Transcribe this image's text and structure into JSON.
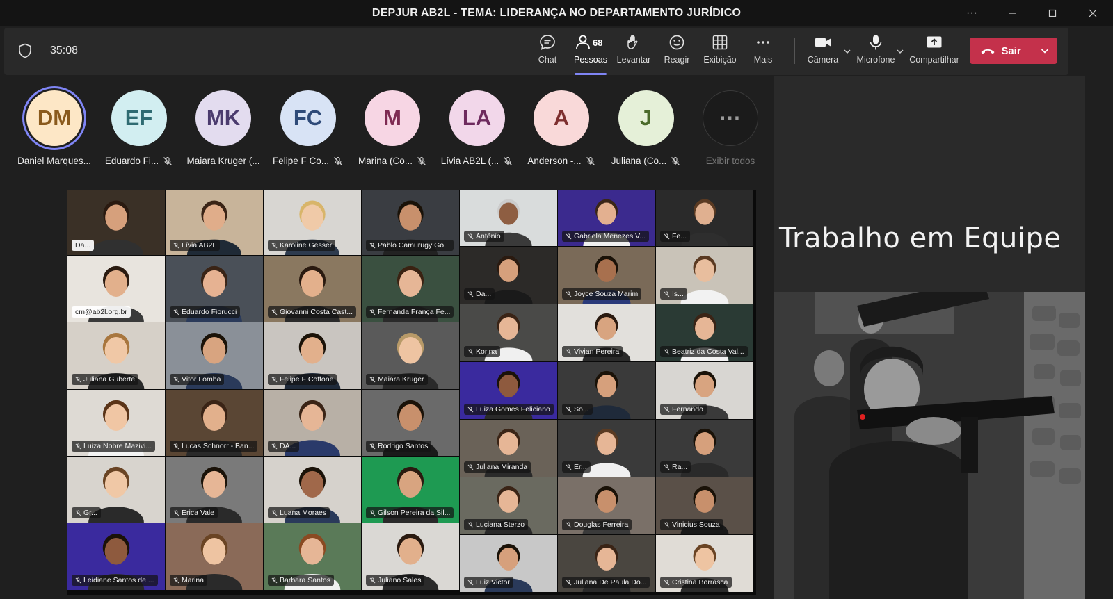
{
  "window": {
    "title": "DEPJUR AB2L - TEMA: LIDERANÇA NO DEPARTAMENTO JURÍDICO"
  },
  "toolbar": {
    "timer": "35:08",
    "participant_count": "68",
    "buttons": {
      "chat": "Chat",
      "people": "Pessoas",
      "raise": "Levantar",
      "react": "Reagir",
      "view": "Exibição",
      "more": "Mais",
      "camera": "Câmera",
      "mic": "Microfone",
      "share": "Compartilhar",
      "leave": "Sair"
    }
  },
  "avatars": [
    {
      "initials": "DM",
      "name": "Daniel Marques...",
      "bg": "#fde7c6",
      "fg": "#8a5a1c",
      "speaking": true,
      "muted": false
    },
    {
      "initials": "EF",
      "name": "Eduardo Fi...",
      "bg": "#d2eef1",
      "fg": "#2f6b72",
      "muted": true
    },
    {
      "initials": "MK",
      "name": "Maiara Kruger (...",
      "bg": "#e3dcef",
      "fg": "#4b3b6e",
      "muted": false
    },
    {
      "initials": "FC",
      "name": "Felipe F Co...",
      "bg": "#d8e3f5",
      "fg": "#2e4a78",
      "muted": true
    },
    {
      "initials": "M",
      "name": "Marina (Co...",
      "bg": "#f7d6e4",
      "fg": "#7e2a52",
      "muted": true
    },
    {
      "initials": "LA",
      "name": "Lívia AB2L (...",
      "bg": "#f2d7ea",
      "fg": "#6e2a5e",
      "muted": true
    },
    {
      "initials": "A",
      "name": "Anderson -...",
      "bg": "#f9d9d9",
      "fg": "#7e2f2f",
      "muted": true
    },
    {
      "initials": "J",
      "name": "Juliana (Co...",
      "bg": "#e5f0d8",
      "fg": "#4a6a2a",
      "muted": true
    }
  ],
  "show_all": {
    "label": "Exibir todos"
  },
  "tiles": [
    {
      "name": "Da...",
      "bg": "#3a3026",
      "skin": "#d6a07c",
      "hair": "#2a1a10",
      "shirt": "#303030",
      "light": true
    },
    {
      "name": "Lívia AB2L",
      "bg": "#c8b49a",
      "skin": "#e0ad8a",
      "hair": "#3a2416",
      "shirt": "#1f2a36"
    },
    {
      "name": "Karoline Gesser",
      "bg": "#d8d6d2",
      "skin": "#f0caa8",
      "hair": "#d8b56a",
      "shirt": "#2e3b4e"
    },
    {
      "name": "Pablo Camurugy Go...",
      "bg": "#3a3d42",
      "skin": "#c8906c",
      "hair": "#1a1208",
      "shirt": "#222222"
    },
    {
      "name": "Antônio",
      "bg": "#d9dcdc",
      "skin": "#8e5e42",
      "hair": "#cccccc",
      "shirt": "#3a3a3a"
    },
    {
      "name": "Gabriela Menezes V...",
      "bg": "#3b2a8e",
      "skin": "#e3b090",
      "hair": "#3a2618",
      "shirt": "#f0f0f0"
    },
    {
      "name": "Fe...",
      "bg": "#2a2a2a",
      "skin": "#e0b090",
      "hair": "#5a3a22",
      "shirt": "#2e2e2e"
    },
    {
      "name": "cm@ab2l.org.br",
      "bg": "#e8e4de",
      "skin": "#e2b08c",
      "hair": "#2a1a10",
      "shirt": "#3a3a3a",
      "light": true
    },
    {
      "name": "Eduardo Fiorucci",
      "bg": "#4a5058",
      "skin": "#e6b292",
      "hair": "#3a2416",
      "shirt": "#2a3a5a"
    },
    {
      "name": "Giovanni Costa Cast...",
      "bg": "#8a7860",
      "skin": "#e3b08c",
      "hair": "#2a1a10",
      "shirt": "#2a2a2a"
    },
    {
      "name": "Fernanda França Fe...",
      "bg": "#3a5040",
      "skin": "#e6b696",
      "hair": "#3a2212",
      "shirt": "#2a2a2a"
    },
    {
      "name": "Da...",
      "bg": "#2c2a28",
      "skin": "#d6a07c",
      "hair": "#2a1a10",
      "shirt": "#1a1a1a"
    },
    {
      "name": "Joyce Souza Marim",
      "bg": "#7a6a58",
      "skin": "#a8704e",
      "hair": "#1a1208",
      "shirt": "#2a3a7a"
    },
    {
      "name": "Is...",
      "bg": "#c9c3b8",
      "skin": "#e8be9e",
      "hair": "#5a3a22",
      "shirt": "#f2f2f2"
    },
    {
      "name": "Juliana Guberte",
      "bg": "#d6d0c8",
      "skin": "#f0c8a6",
      "hair": "#a8763e",
      "shirt": "#2a2a2a"
    },
    {
      "name": "Vitor Lomba",
      "bg": "#8a9098",
      "skin": "#d8a480",
      "hair": "#1a1208",
      "shirt": "#2a3a5a"
    },
    {
      "name": "Felipe F Coffone",
      "bg": "#c9c5c0",
      "skin": "#e2b08c",
      "hair": "#1a1208",
      "shirt": "#1f2a3a"
    },
    {
      "name": "Maiara Kruger",
      "bg": "#5a5a5a",
      "skin": "#eec4a2",
      "hair": "#b89a68",
      "shirt": "#2a2a2a"
    },
    {
      "name": "Korina",
      "bg": "#4a4a48",
      "skin": "#e6b696",
      "hair": "#3a2416",
      "shirt": "#f0f0f0"
    },
    {
      "name": "Vivian Pereira",
      "bg": "#e2e0dc",
      "skin": "#d8a480",
      "hair": "#2a1a10",
      "shirt": "#2a2a2a"
    },
    {
      "name": "Beatriz da Costa Val...",
      "bg": "#2a3a34",
      "skin": "#e6b696",
      "hair": "#3a2416",
      "shirt": "#f2f2f2"
    },
    {
      "name": "Luiza Gomes Feliciano",
      "bg": "#3a2a9e",
      "skin": "#8e5a3e",
      "hair": "#1a1208",
      "shirt": "#2a2a2a"
    },
    {
      "name": "So...",
      "bg": "#3a3a3a",
      "skin": "#d6a07c",
      "hair": "#1a1208",
      "shirt": "#1f2a3a"
    },
    {
      "name": "Fernando",
      "bg": "#d8d6d2",
      "skin": "#d8a480",
      "hair": "#1a1208",
      "shirt": "#3a3a3a"
    },
    {
      "name": "Luiza Nobre Mazivi...",
      "bg": "#dedad4",
      "skin": "#f0c6a4",
      "hair": "#5a3418",
      "shirt": "#f4f4f4"
    },
    {
      "name": "Lucas Schnorr - Ban...",
      "bg": "#5a4634",
      "skin": "#e2b08c",
      "hair": "#3a2416",
      "shirt": "#2a2a2a"
    },
    {
      "name": "DA...",
      "bg": "#b8b0a6",
      "skin": "#e6b696",
      "hair": "#3a2416",
      "shirt": "#2a3a6a"
    },
    {
      "name": "Rodrigo Santos",
      "bg": "#6a6a6a",
      "skin": "#c8906c",
      "hair": "#1a1208",
      "shirt": "#1a1a1a"
    },
    {
      "name": "Juliana Miranda",
      "bg": "#6a6258",
      "skin": "#e6b696",
      "hair": "#3a2416",
      "shirt": "#2a2a2a"
    },
    {
      "name": "Er...",
      "bg": "#3a3a3a",
      "skin": "#e6b696",
      "hair": "#5a3a22",
      "shirt": "#f0f0f0"
    },
    {
      "name": "Ra...",
      "bg": "#3a3a3a",
      "skin": "#d6a07c",
      "hair": "#1a1208",
      "shirt": "#2a2a2a"
    },
    {
      "name": "Gr...",
      "bg": "#d8d4ce",
      "skin": "#f0c8a6",
      "hair": "#6a4424",
      "shirt": "#2a2a2a"
    },
    {
      "name": "Érica Vale",
      "bg": "#7a7a7a",
      "skin": "#e6b696",
      "hair": "#1a1208",
      "shirt": "#2a2a2a"
    },
    {
      "name": "Luana Moraes",
      "bg": "#d6d2cc",
      "skin": "#a0684a",
      "hair": "#1a1208",
      "shirt": "#2a3a5a"
    },
    {
      "name": "Gilson Pereira da Sil...",
      "bg": "#1e9a52",
      "skin": "#d8a480",
      "hair": "#2a1a10",
      "shirt": "#2a2a2a"
    },
    {
      "name": "Luciana Sterzo",
      "bg": "#6a6a60",
      "skin": "#e6b696",
      "hair": "#3a2416",
      "shirt": "#2a2a2a"
    },
    {
      "name": "Douglas Ferreira",
      "bg": "#7a7068",
      "skin": "#c8906c",
      "hair": "#1a1208",
      "shirt": "#3a3a3a"
    },
    {
      "name": "Vinicius Souza",
      "bg": "#5a5048",
      "skin": "#c8906c",
      "hair": "#1a1208",
      "shirt": "#1a1a1a"
    },
    {
      "name": "Leidiane Santos de ...",
      "bg": "#3a2a9e",
      "skin": "#8e5a3e",
      "hair": "#1a1208",
      "shirt": "#2a2a2a"
    },
    {
      "name": "Marina",
      "bg": "#8a6a58",
      "skin": "#eec4a2",
      "hair": "#6a4424",
      "shirt": "#2a2a2a"
    },
    {
      "name": "Barbara Santos",
      "bg": "#5a7a58",
      "skin": "#e6b696",
      "hair": "#8a4a22",
      "shirt": "#f0f0f0"
    },
    {
      "name": "Juliano Sales",
      "bg": "#dad8d4",
      "skin": "#e2b08c",
      "hair": "#2a1a10",
      "shirt": "#2a2a2a"
    },
    {
      "name": "Luiz Victor",
      "bg": "#c8c8c8",
      "skin": "#d6a07c",
      "hair": "#1a1208",
      "shirt": "#2a3a5a"
    },
    {
      "name": "Juliana De Paula Do...",
      "bg": "#4a4640",
      "skin": "#e6b696",
      "hair": "#3a2416",
      "shirt": "#2a2a2a"
    },
    {
      "name": "Cristina Borrasca",
      "bg": "#e0dcd6",
      "skin": "#eec4a2",
      "hair": "#6a4424",
      "shirt": "#2a2a2a"
    }
  ],
  "slide": {
    "title": "Trabalho em Equipe"
  },
  "colors": {
    "accent": "#7f85f5",
    "leave": "#c4314b"
  }
}
